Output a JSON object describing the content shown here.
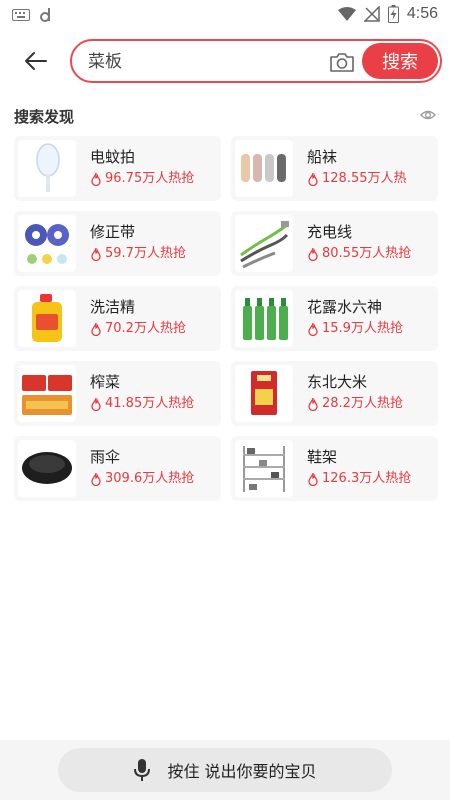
{
  "status_bar": {
    "time": "4:56",
    "left_icons": [
      "keyboard-icon",
      "d-notification-icon"
    ],
    "right_icons": [
      "wifi-icon",
      "no-signal-icon",
      "battery-charging-icon"
    ]
  },
  "search": {
    "placeholder": "菜板",
    "button_label": "搜索",
    "icons": [
      "back-arrow-icon",
      "camera-icon"
    ]
  },
  "discover": {
    "title": "搜索发现",
    "icon": "eye-icon",
    "items": [
      {
        "name": "电蚊拍",
        "heat": "96.75万人热抢",
        "thumb": "mosquito-swatter"
      },
      {
        "name": "船袜",
        "heat": "128.55万人热",
        "thumb": "socks"
      },
      {
        "name": "修正带",
        "heat": "59.7万人热抢",
        "thumb": "correction-tape"
      },
      {
        "name": "充电线",
        "heat": "80.55万人热抢",
        "thumb": "charging-cable"
      },
      {
        "name": "洗洁精",
        "heat": "70.2万人热抢",
        "thumb": "dish-soap"
      },
      {
        "name": "花露水六神",
        "heat": "15.9万人热抢",
        "thumb": "floral-water"
      },
      {
        "name": "榨菜",
        "heat": "41.85万人热抢",
        "thumb": "pickles"
      },
      {
        "name": "东北大米",
        "heat": "28.2万人热抢",
        "thumb": "rice-bag"
      },
      {
        "name": "雨伞",
        "heat": "309.6万人热抢",
        "thumb": "umbrella"
      },
      {
        "name": "鞋架",
        "heat": "126.3万人热抢",
        "thumb": "shoe-rack"
      }
    ]
  },
  "voice": {
    "label": "按住 说出你要的宝贝",
    "icon": "microphone-icon"
  },
  "colors": {
    "accent": "#ea3f46",
    "heat_text": "#e53b41",
    "card_bg": "#f7f7f7"
  }
}
